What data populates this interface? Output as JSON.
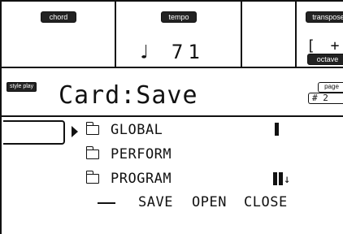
{
  "header": {
    "chord_label": "chord",
    "tempo_label": "tempo",
    "tempo_value": "♩ 71",
    "transpose_label": "transpose",
    "transpose_value": "[ +",
    "octave_label": "octave"
  },
  "mode_badge": "style play",
  "page": {
    "title": "Card:Save",
    "page_tag": "page",
    "page_number": "# 2"
  },
  "bank_box_value": "",
  "folders": [
    {
      "name": "GLOBAL",
      "selected": true
    },
    {
      "name": "PERFORM",
      "selected": false
    },
    {
      "name": "PROGRAM",
      "selected": true
    }
  ],
  "scroll_indicator": "↓",
  "buttons": {
    "dash": "—",
    "save": "SAVE",
    "open": "OPEN",
    "close": "CLOSE"
  }
}
